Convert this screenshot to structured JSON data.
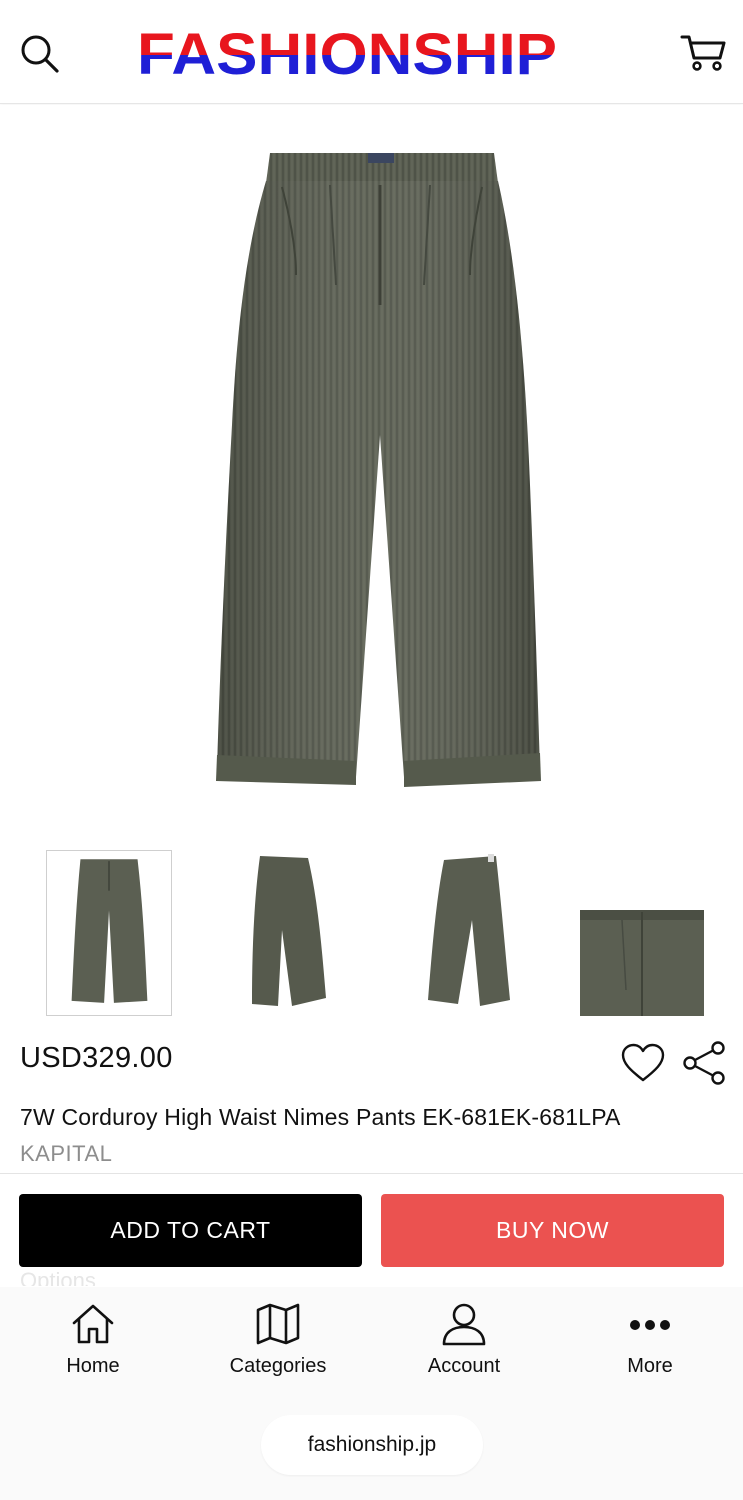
{
  "header": {
    "logo_text": "FASHIONSHIP",
    "icons": {
      "search": "search-icon",
      "cart": "cart-icon"
    }
  },
  "product": {
    "price": "USD329.00",
    "title": "7W Corduroy High Waist Nimes Pants EK-681EK-681LPA",
    "brand": "KAPITAL",
    "thumbnails": [
      "front",
      "side",
      "back",
      "detail"
    ],
    "selected_thumbnail": 0,
    "icons": {
      "favorite": "heart-icon",
      "share": "share-icon"
    }
  },
  "actions": {
    "add_to_cart": "ADD TO CART",
    "buy_now": "BUY NOW"
  },
  "options_label": "Options",
  "tabbar": {
    "items": [
      {
        "label": "Home",
        "icon": "home-icon"
      },
      {
        "label": "Categories",
        "icon": "map-icon"
      },
      {
        "label": "Account",
        "icon": "user-icon"
      },
      {
        "label": "More",
        "icon": "more-icon"
      }
    ]
  },
  "browser": {
    "url": "fashionship.jp"
  },
  "colors": {
    "logo_red": "#e8161e",
    "logo_blue": "#1f1fd6",
    "buy_now": "#eb5250",
    "add_to_cart": "#000000",
    "brand_text": "#8d8d8d",
    "pants": "#5b5f52"
  }
}
